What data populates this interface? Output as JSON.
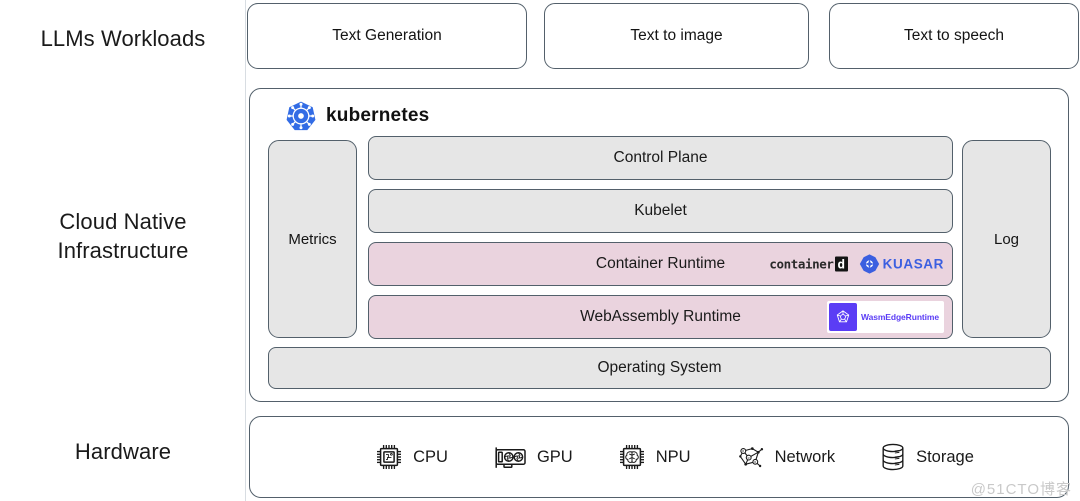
{
  "layers": {
    "workloads_label": "LLMs Workloads",
    "infrastructure_label": "Cloud Native\nInfrastructure",
    "hardware_label": "Hardware"
  },
  "workloads": {
    "items": [
      {
        "label": "Text Generation"
      },
      {
        "label": "Text to image"
      },
      {
        "label": "Text to speech"
      }
    ]
  },
  "kubernetes": {
    "title": "kubernetes",
    "logo_icon": "kubernetes-helm-wheel-icon",
    "logo_color": "#326ce5",
    "side_boxes": [
      {
        "label": "Metrics"
      },
      {
        "label": "Log"
      }
    ],
    "stack": [
      {
        "label": "Control Plane",
        "fill": "#e6e6e6"
      },
      {
        "label": "Kubelet",
        "fill": "#e6e6e6"
      },
      {
        "label": "Container Runtime",
        "fill": "#ead3de"
      },
      {
        "label": "WebAssembly Runtime",
        "fill": "#ead3de"
      }
    ],
    "operating_system": {
      "label": "Operating System",
      "fill": "#e6e6e6"
    },
    "runtime_logos": {
      "containerd": {
        "text": "container",
        "boxed_letter": "d"
      },
      "kuasar": {
        "text": "KUASAR",
        "color": "#3b5fe0",
        "icon": "kuasar-star-icon"
      },
      "wasmedge": {
        "text": "WasmEdgeRuntime",
        "color": "#5b3df5",
        "icon": "wasmedge-pentagon-icon"
      }
    }
  },
  "hardware": {
    "items": [
      {
        "label": "CPU",
        "icon": "cpu-chip-icon"
      },
      {
        "label": "GPU",
        "icon": "gpu-card-icon"
      },
      {
        "label": "NPU",
        "icon": "npu-brain-chip-icon"
      },
      {
        "label": "Network",
        "icon": "network-nodes-icon"
      },
      {
        "label": "Storage",
        "icon": "database-cylinder-icon"
      }
    ]
  },
  "watermark": {
    "text": "@51CTO博客"
  }
}
